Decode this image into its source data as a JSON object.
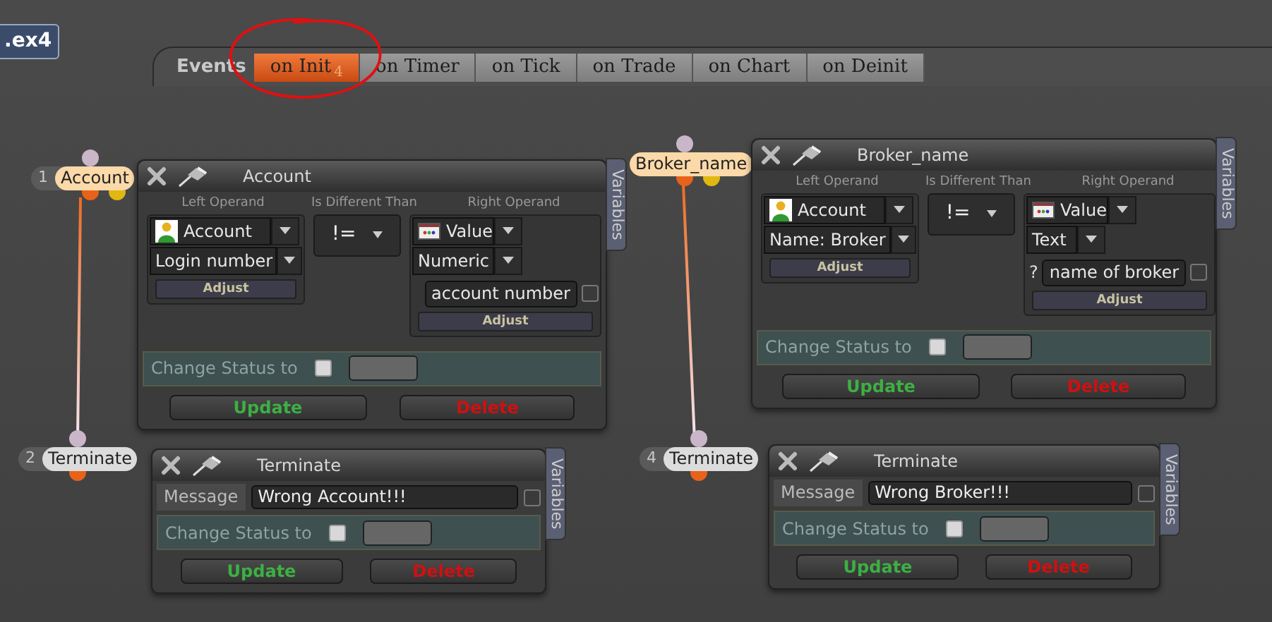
{
  "file_label": ".ex4",
  "events": {
    "label": "Events",
    "tabs": [
      {
        "label": "on Init",
        "selected": true,
        "badge": "4"
      },
      {
        "label": "on Timer",
        "selected": false
      },
      {
        "label": "on Tick",
        "selected": false
      },
      {
        "label": "on Trade",
        "selected": false
      },
      {
        "label": "on Chart",
        "selected": false
      },
      {
        "label": "on Deinit",
        "selected": false
      }
    ]
  },
  "nodes": [
    {
      "number": "1",
      "label": "Account",
      "kind": "condition",
      "panel": {
        "title": "Account",
        "variables": "Variables",
        "left_label": "Left Operand",
        "operator_label": "Is Different Than",
        "right_label": "Right Operand",
        "left": {
          "source": "Account",
          "field": "Login number",
          "adjust": "Adjust"
        },
        "operator": "!=",
        "right": {
          "source": "Value",
          "type": "Numeric",
          "value": "account number",
          "value_checked": false,
          "adjust": "Adjust"
        },
        "status_label": "Change Status to",
        "status_checked": false,
        "update": "Update",
        "delete": "Delete"
      }
    },
    {
      "number": "2",
      "label": "Terminate",
      "kind": "action",
      "panel": {
        "title": "Terminate",
        "variables": "Variables",
        "message_label": "Message",
        "message": "Wrong Account!!!",
        "message_checked": false,
        "status_label": "Change Status to",
        "status_checked": false,
        "update": "Update",
        "delete": "Delete"
      }
    },
    {
      "label": "Broker_name",
      "kind": "condition",
      "panel": {
        "title": "Broker_name",
        "variables": "Variables",
        "left_label": "Left Operand",
        "operator_label": "Is Different Than",
        "right_label": "Right Operand",
        "left": {
          "source": "Account",
          "field": "Name: Broker",
          "adjust": "Adjust"
        },
        "operator": "!=",
        "right": {
          "source": "Value",
          "type": "Text",
          "prefix": "?",
          "value": "name of broker",
          "value_checked": false,
          "adjust": "Adjust"
        },
        "status_label": "Change Status to",
        "status_checked": false,
        "update": "Update",
        "delete": "Delete"
      }
    },
    {
      "number": "4",
      "label": "Terminate",
      "kind": "action",
      "panel": {
        "title": "Terminate",
        "variables": "Variables",
        "message_label": "Message",
        "message": "Wrong Broker!!!",
        "message_checked": false,
        "status_label": "Change Status to",
        "status_checked": false,
        "update": "Update",
        "delete": "Delete"
      }
    }
  ]
}
